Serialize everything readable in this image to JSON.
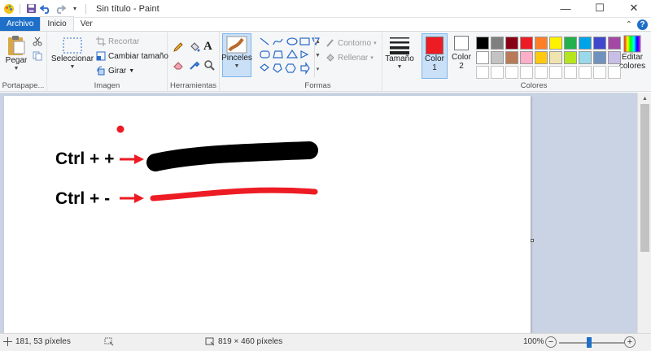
{
  "window": {
    "title": "Sin título - Paint",
    "minimize_label": "—",
    "maximize_label": "☐",
    "close_label": "✕"
  },
  "tabs": [
    {
      "label": "Archivo"
    },
    {
      "label": "Inicio"
    },
    {
      "label": "Ver"
    }
  ],
  "help_label": "?",
  "collapse_label": "⌃",
  "ribbon": {
    "clipboard": {
      "paste_label": "Pegar",
      "group_label": "Portapape..."
    },
    "image": {
      "select_label": "Seleccionar",
      "crop_label": "Recortar",
      "resize_label": "Cambiar tamaño",
      "rotate_label": "Girar",
      "group_label": "Imagen"
    },
    "tools": {
      "group_label": "Herramientas",
      "text_glyph": "A"
    },
    "brushes": {
      "label": "Pinceles"
    },
    "shapes": {
      "outline_label": "Contorno",
      "fill_label": "Rellenar",
      "group_label": "Formas"
    },
    "size": {
      "label": "Tamaño"
    },
    "colors": {
      "color1_label": "Color",
      "color1_num": "1",
      "color2_label": "Color",
      "color2_num": "2",
      "edit_label": "Editar",
      "edit_label2": "colores",
      "group_label": "Colores",
      "color1_value": "#ed1c24",
      "color2_value": "#ffffff",
      "palette": [
        "#000000",
        "#7f7f7f",
        "#880015",
        "#ed1c24",
        "#ff7f27",
        "#fff200",
        "#22b14c",
        "#00a2e8",
        "#3f48cc",
        "#a349a4",
        "#ffffff",
        "#c3c3c3",
        "#b97a57",
        "#ffaec9",
        "#ffc90e",
        "#efe4b0",
        "#b5e61d",
        "#99d9ea",
        "#7092be",
        "#c8bfe7"
      ]
    }
  },
  "canvas": {
    "line1_text": "Ctrl + +",
    "line2_text": "Ctrl + -"
  },
  "status": {
    "cursor_pos": "181, 53 píxeles",
    "canvas_size": "819 × 460 píxeles",
    "zoom": "100%"
  }
}
